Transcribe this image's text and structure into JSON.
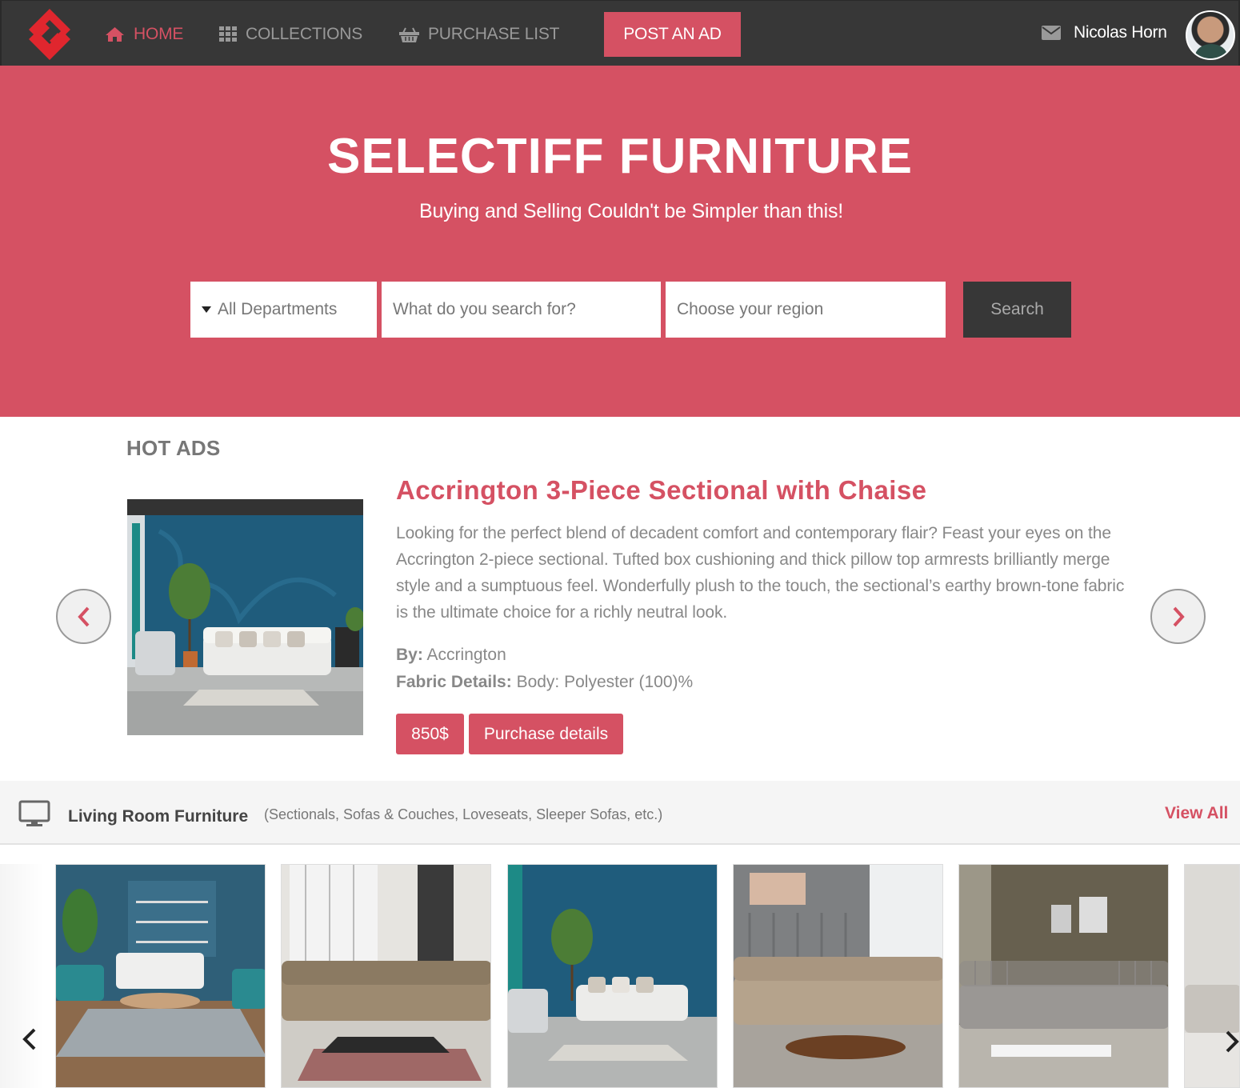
{
  "nav": {
    "home": "HOME",
    "collections": "COLLECTIONS",
    "purchase_list": "PURCHASE LIST",
    "post_ad": "POST AN AD",
    "user_name": "Nicolas Horn"
  },
  "hero": {
    "title": "SELECTIFF FURNITURE",
    "subtitle": "Buying and Selling Couldn't be Simpler than this!",
    "department_selected": "All Departments",
    "search_placeholder": "What do you search for?",
    "region_placeholder": "Choose your region",
    "search_label": "Search"
  },
  "hot_ads": {
    "title": "HOT ADS",
    "item": {
      "name": "Accrington 3-Piece Sectional with Chaise",
      "description": "Looking for the perfect blend of decadent comfort and contemporary flair? Feast your eyes on the Accrington 2-piece sectional. Tufted box cushioning and thick pillow top armrests brilliantly merge style and a sumptuous feel. Wonderfully plush to the touch, the sectional’s earthy brown-tone fabric is the ultimate choice for a richly neutral look.",
      "by_label": "By:",
      "by_value": "Accrington",
      "fabric_label": "Fabric Details:",
      "fabric_value": "Body: Polyester (100)%",
      "price": "850$",
      "details_label": "Purchase details"
    }
  },
  "category": {
    "name": "Living Room Furniture",
    "subtitle": "(Sectionals, Sofas & Couches, Loveseats, Sleeper Sofas, etc.)",
    "view_all": "View All"
  },
  "colors": {
    "brand": "#d55163",
    "dark": "#373737"
  },
  "icons": [
    "home-icon",
    "grid-icon",
    "basket-icon",
    "mail-icon",
    "chevron-left-icon",
    "chevron-right-icon",
    "monitor-icon"
  ]
}
